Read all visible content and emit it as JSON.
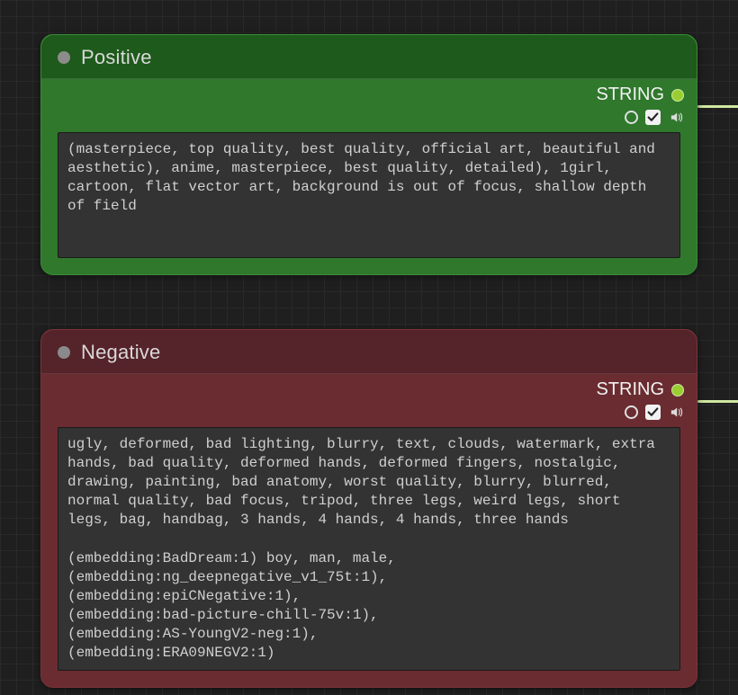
{
  "nodes": {
    "positive": {
      "title": "Positive",
      "output_type": "STRING",
      "checkbox_checked": true,
      "prompt": "(masterpiece, top quality, best quality, official art, beautiful and aesthetic), anime, masterpiece, best quality, detailed), 1girl, cartoon, flat vector art, background is out of focus, shallow depth of field"
    },
    "negative": {
      "title": "Negative",
      "output_type": "STRING",
      "checkbox_checked": true,
      "prompt": "ugly, deformed, bad lighting, blurry, text, clouds, watermark, extra hands, bad quality, deformed hands, deformed fingers, nostalgic, drawing, painting, bad anatomy, worst quality, blurry, blurred, normal quality, bad focus, tripod, three legs, weird legs, short legs, bag, handbag, 3 hands, 4 hands, 4 hands, three hands\n\n(embedding:BadDream:1) boy, man, male,\n(embedding:ng_deepnegative_v1_75t:1),\n(embedding:epiCNegative:1),\n(embedding:bad-picture-chill-75v:1),\n(embedding:AS-YoungV2-neg:1),\n(embedding:ERA09NEGV2:1)"
    }
  },
  "colors": {
    "positive": "#2f782c",
    "negative": "#6a2c30",
    "output_dot": "#9acd32"
  }
}
